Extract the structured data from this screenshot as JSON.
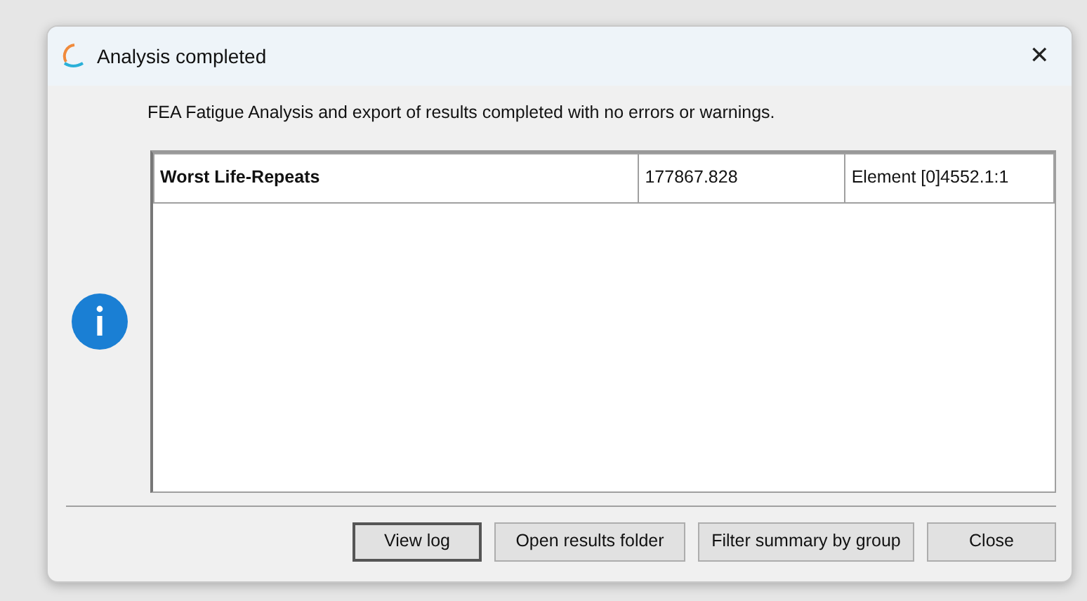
{
  "window": {
    "title": "Analysis completed",
    "close": "✕"
  },
  "message": "FEA Fatigue Analysis and export of results completed with no errors or warnings.",
  "table": {
    "rows": [
      {
        "cells": [
          "Worst Life-Repeats",
          "177867.828",
          "Element [0]4552.1:1"
        ]
      }
    ]
  },
  "buttons": [
    {
      "label": "View log",
      "default": true
    },
    {
      "label": "Open results folder",
      "default": false
    },
    {
      "label": "Filter summary by group",
      "default": false
    },
    {
      "label": "Close",
      "default": false
    }
  ]
}
